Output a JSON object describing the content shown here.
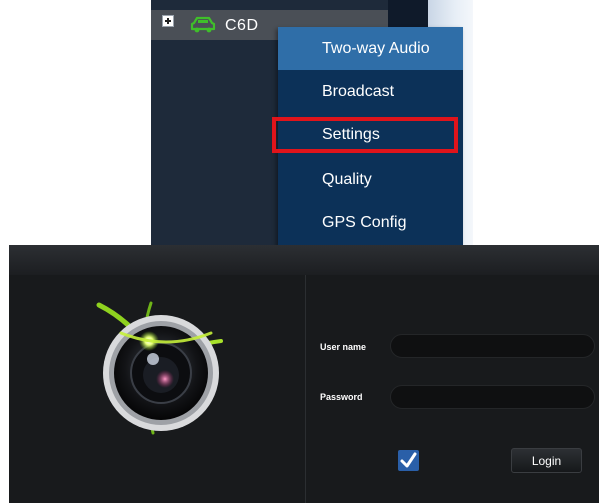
{
  "tree": {
    "device_name": "C6D",
    "device_icon": "car-icon"
  },
  "context_menu": {
    "items": [
      {
        "label": "Two-way Audio"
      },
      {
        "label": "Broadcast"
      },
      {
        "label": "Settings"
      },
      {
        "label": "Quality"
      },
      {
        "label": "GPS Config"
      }
    ],
    "highlighted_item": "Settings",
    "highlight_color": "#e0141b"
  },
  "login": {
    "username_label": "User name",
    "password_label": "Password",
    "username_value": "",
    "password_value": "",
    "remember_checked": true,
    "login_button": "Login"
  },
  "colors": {
    "menu_bg": "#0c3158",
    "menu_active_bg": "#2f6ea8",
    "vehicle_icon": "#3fbf2a",
    "login_bg": "#181a1c",
    "checkbox": "#2a5fa8"
  }
}
